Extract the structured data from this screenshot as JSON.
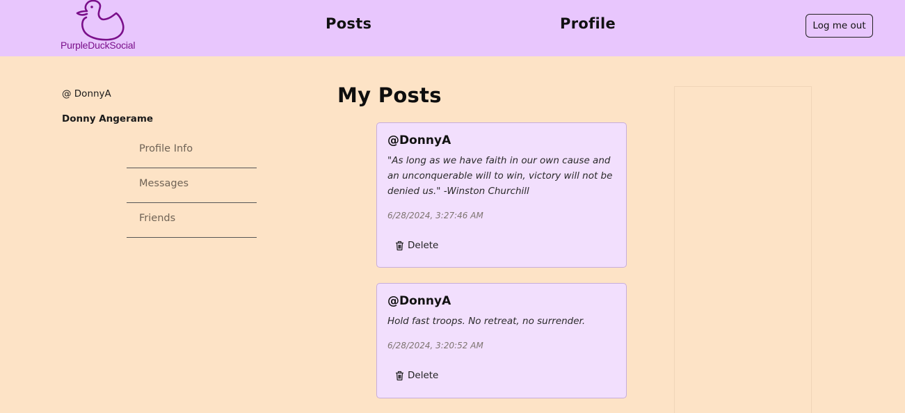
{
  "header": {
    "logo_text": "PurpleDuckSocial",
    "nav": {
      "posts": "Posts",
      "profile": "Profile"
    },
    "logout_label": "Log me out"
  },
  "user": {
    "handle": "@ DonnyA",
    "full_name": "Donny Angerame"
  },
  "sidebar": {
    "items": [
      {
        "label": "Profile Info"
      },
      {
        "label": "Messages"
      },
      {
        "label": "Friends"
      }
    ]
  },
  "main": {
    "title": "My Posts",
    "posts": [
      {
        "author": "@DonnyA",
        "body": "\"As long as we have faith in our own cause and an unconquerable will to win, victory will not be denied us.\" -Winston Churchill",
        "date": "6/28/2024, 3:27:46 AM",
        "delete_label": "Delete"
      },
      {
        "author": "@DonnyA",
        "body": "Hold fast troops. No retreat, no surrender.",
        "date": "6/28/2024, 3:20:52 AM",
        "delete_label": "Delete"
      }
    ]
  },
  "colors": {
    "navbar_bg": "#e8c6fd",
    "page_bg": "#fde3c6",
    "card_bg": "#f2dffd",
    "logo_purple": "#7a0f8a"
  },
  "icons": {
    "logo": "duck-icon",
    "delete": "trash-icon"
  }
}
